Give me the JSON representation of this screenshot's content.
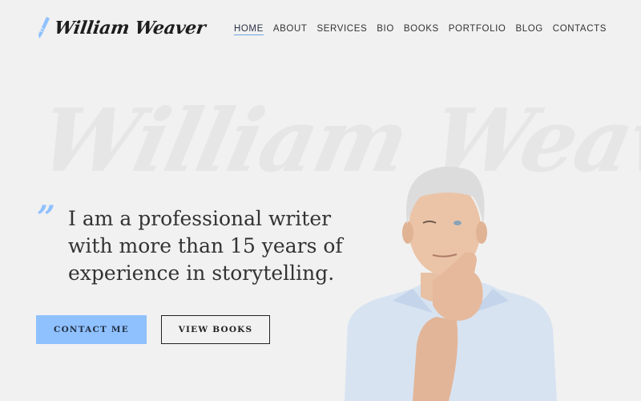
{
  "header": {
    "logo_text": "William Weaver",
    "logo_icon": "pen-nib-icon"
  },
  "nav": {
    "items": [
      {
        "label": "HOME",
        "active": true
      },
      {
        "label": "ABOUT",
        "active": false
      },
      {
        "label": "SERVICES",
        "active": false
      },
      {
        "label": "BIO",
        "active": false
      },
      {
        "label": "BOOKS",
        "active": false
      },
      {
        "label": "PORTFOLIO",
        "active": false
      },
      {
        "label": "BLOG",
        "active": false
      },
      {
        "label": "CONTACTS",
        "active": false
      }
    ]
  },
  "hero": {
    "watermark": "William Weaver",
    "quote_mark": "”",
    "quote": "I am a professional writer with more than 15 years of experience in storytelling.",
    "primary_button": "CONTACT ME",
    "secondary_button": "VIEW BOOKS",
    "portrait_alt": "Gray-haired man in light blue shirt, hand on chin"
  },
  "colors": {
    "accent": "#8fc1ff",
    "background": "#f1f1f1",
    "text": "#333333",
    "watermark": "#e6e6e6"
  }
}
